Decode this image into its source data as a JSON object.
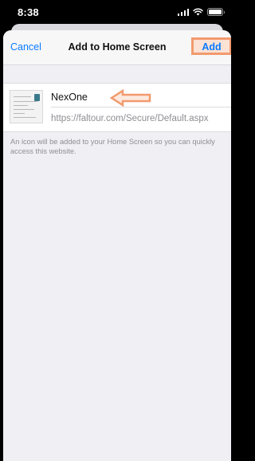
{
  "status_bar": {
    "time": "8:38"
  },
  "nav": {
    "cancel_label": "Cancel",
    "title": "Add to Home Screen",
    "add_label": "Add"
  },
  "shortcut": {
    "name": "NexOne",
    "url": "https://faltour.com/Secure/Default.aspx"
  },
  "description": "An icon will be added to your Home Screen so you can quickly access this website.",
  "colors": {
    "accent": "#0a7aff",
    "annotation": "#f29a6e",
    "sheet_background": "#efeff4"
  },
  "icons": {
    "annotation_arrow": "left-arrow-icon"
  }
}
